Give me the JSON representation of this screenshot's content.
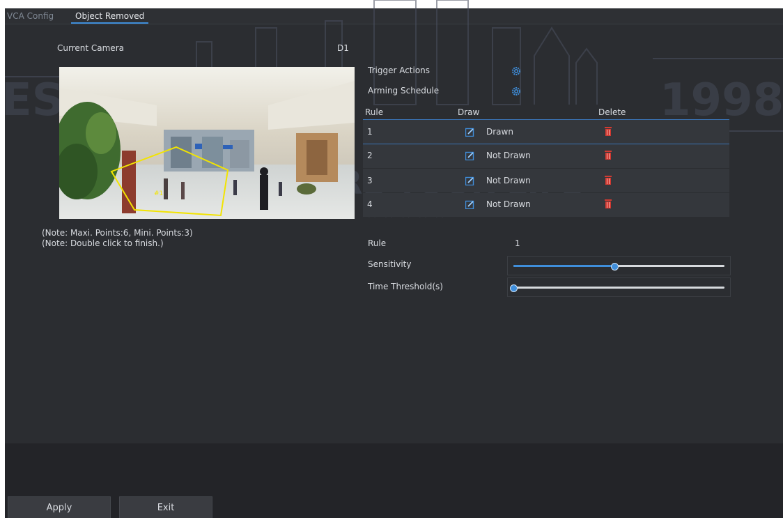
{
  "tabs": [
    {
      "label": "VCA Config"
    },
    {
      "label": "Object Removed"
    }
  ],
  "camera": {
    "label": "Current Camera",
    "value": "D1"
  },
  "preview": {
    "region_label": "#1"
  },
  "notes": [
    "(Note: Maxi. Points:6, Mini. Points:3)",
    "(Note: Double click to finish.)"
  ],
  "trigger_actions_label": "Trigger Actions",
  "arming_schedule_label": "Arming Schedule",
  "rules_table": {
    "headers": {
      "rule": "Rule",
      "draw": "Draw",
      "delete": "Delete"
    },
    "rows": [
      {
        "rule": "1",
        "status": "Drawn"
      },
      {
        "rule": "2",
        "status": "Not Drawn"
      },
      {
        "rule": "3",
        "status": "Not Drawn"
      },
      {
        "rule": "4",
        "status": "Not Drawn"
      }
    ]
  },
  "rule_detail": {
    "rule_label": "Rule",
    "rule_value": "1",
    "sensitivity_label": "Sensitivity",
    "sensitivity_level": 0.48,
    "time_threshold_label": "Time Threshold(s)",
    "time_threshold_level": 0.0
  },
  "footer": {
    "apply_label": "Apply",
    "exit_label": "Exit"
  },
  "colors": {
    "accent": "#3f8edb",
    "delete": "#d23a32",
    "region": "#f2e400",
    "panel_bg": "#2b2d31"
  },
  "watermark": {
    "left_text": "EST",
    "right_text": "1998",
    "middle_text": "RE YOUR LIFE"
  },
  "icons": {
    "gear": "gear-icon",
    "edit": "edit-icon",
    "delete": "trash-icon"
  }
}
